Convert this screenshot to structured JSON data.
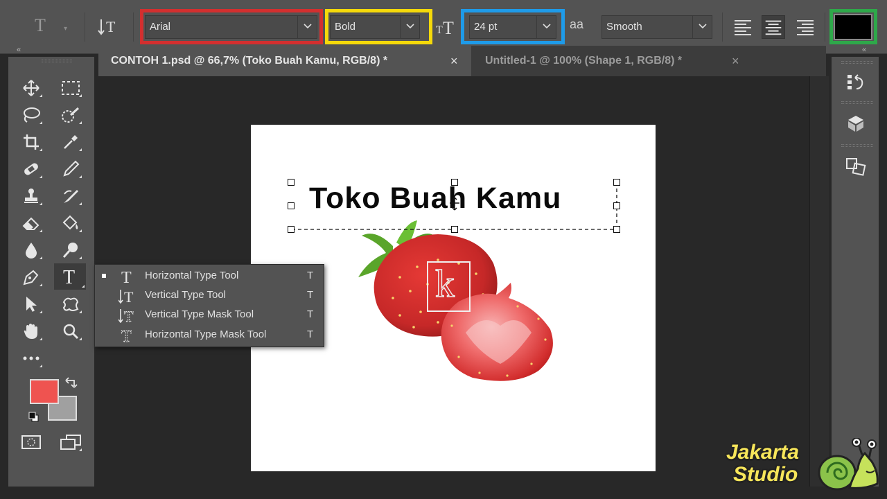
{
  "options_bar": {
    "tool_preset_glyph": "T",
    "font_family": "Arial",
    "font_style": "Bold",
    "font_size": "24 pt",
    "aa_label": "aa",
    "antialias": "Smooth",
    "text_color": "#000000",
    "highlight_colors": {
      "font_family": "#d32f2f",
      "font_style": "#f5d90a",
      "font_size": "#1e9be9",
      "text_color": "#2ea84a"
    }
  },
  "tabs": [
    {
      "label": "CONTOH 1.psd @ 66,7% (Toko Buah Kamu, RGB/8) *",
      "close": "×"
    },
    {
      "label": "Untitled-1 @ 100% (Shape 1, RGB/8) *",
      "close": "×"
    }
  ],
  "toolbar": {
    "collapse": "«",
    "foreground_color": "#ef5350",
    "background_color": "#a0a0a0"
  },
  "flyout": {
    "items": [
      {
        "label": "Horizontal Type Tool",
        "shortcut": "T",
        "selected": true,
        "icon": "horizontal-type-icon"
      },
      {
        "label": "Vertical Type Tool",
        "shortcut": "T",
        "selected": false,
        "icon": "vertical-type-icon"
      },
      {
        "label": "Vertical Type Mask Tool",
        "shortcut": "T",
        "selected": false,
        "icon": "vertical-type-mask-icon"
      },
      {
        "label": "Horizontal Type Mask Tool",
        "shortcut": "T",
        "selected": false,
        "icon": "horizontal-type-mask-icon"
      }
    ]
  },
  "document": {
    "text_layer": "Toko Buah Kamu",
    "overlay_letter": "k"
  },
  "right_panel": {
    "collapse": "«"
  },
  "watermark": {
    "line1": "Jakarta",
    "line2": "Studio"
  }
}
